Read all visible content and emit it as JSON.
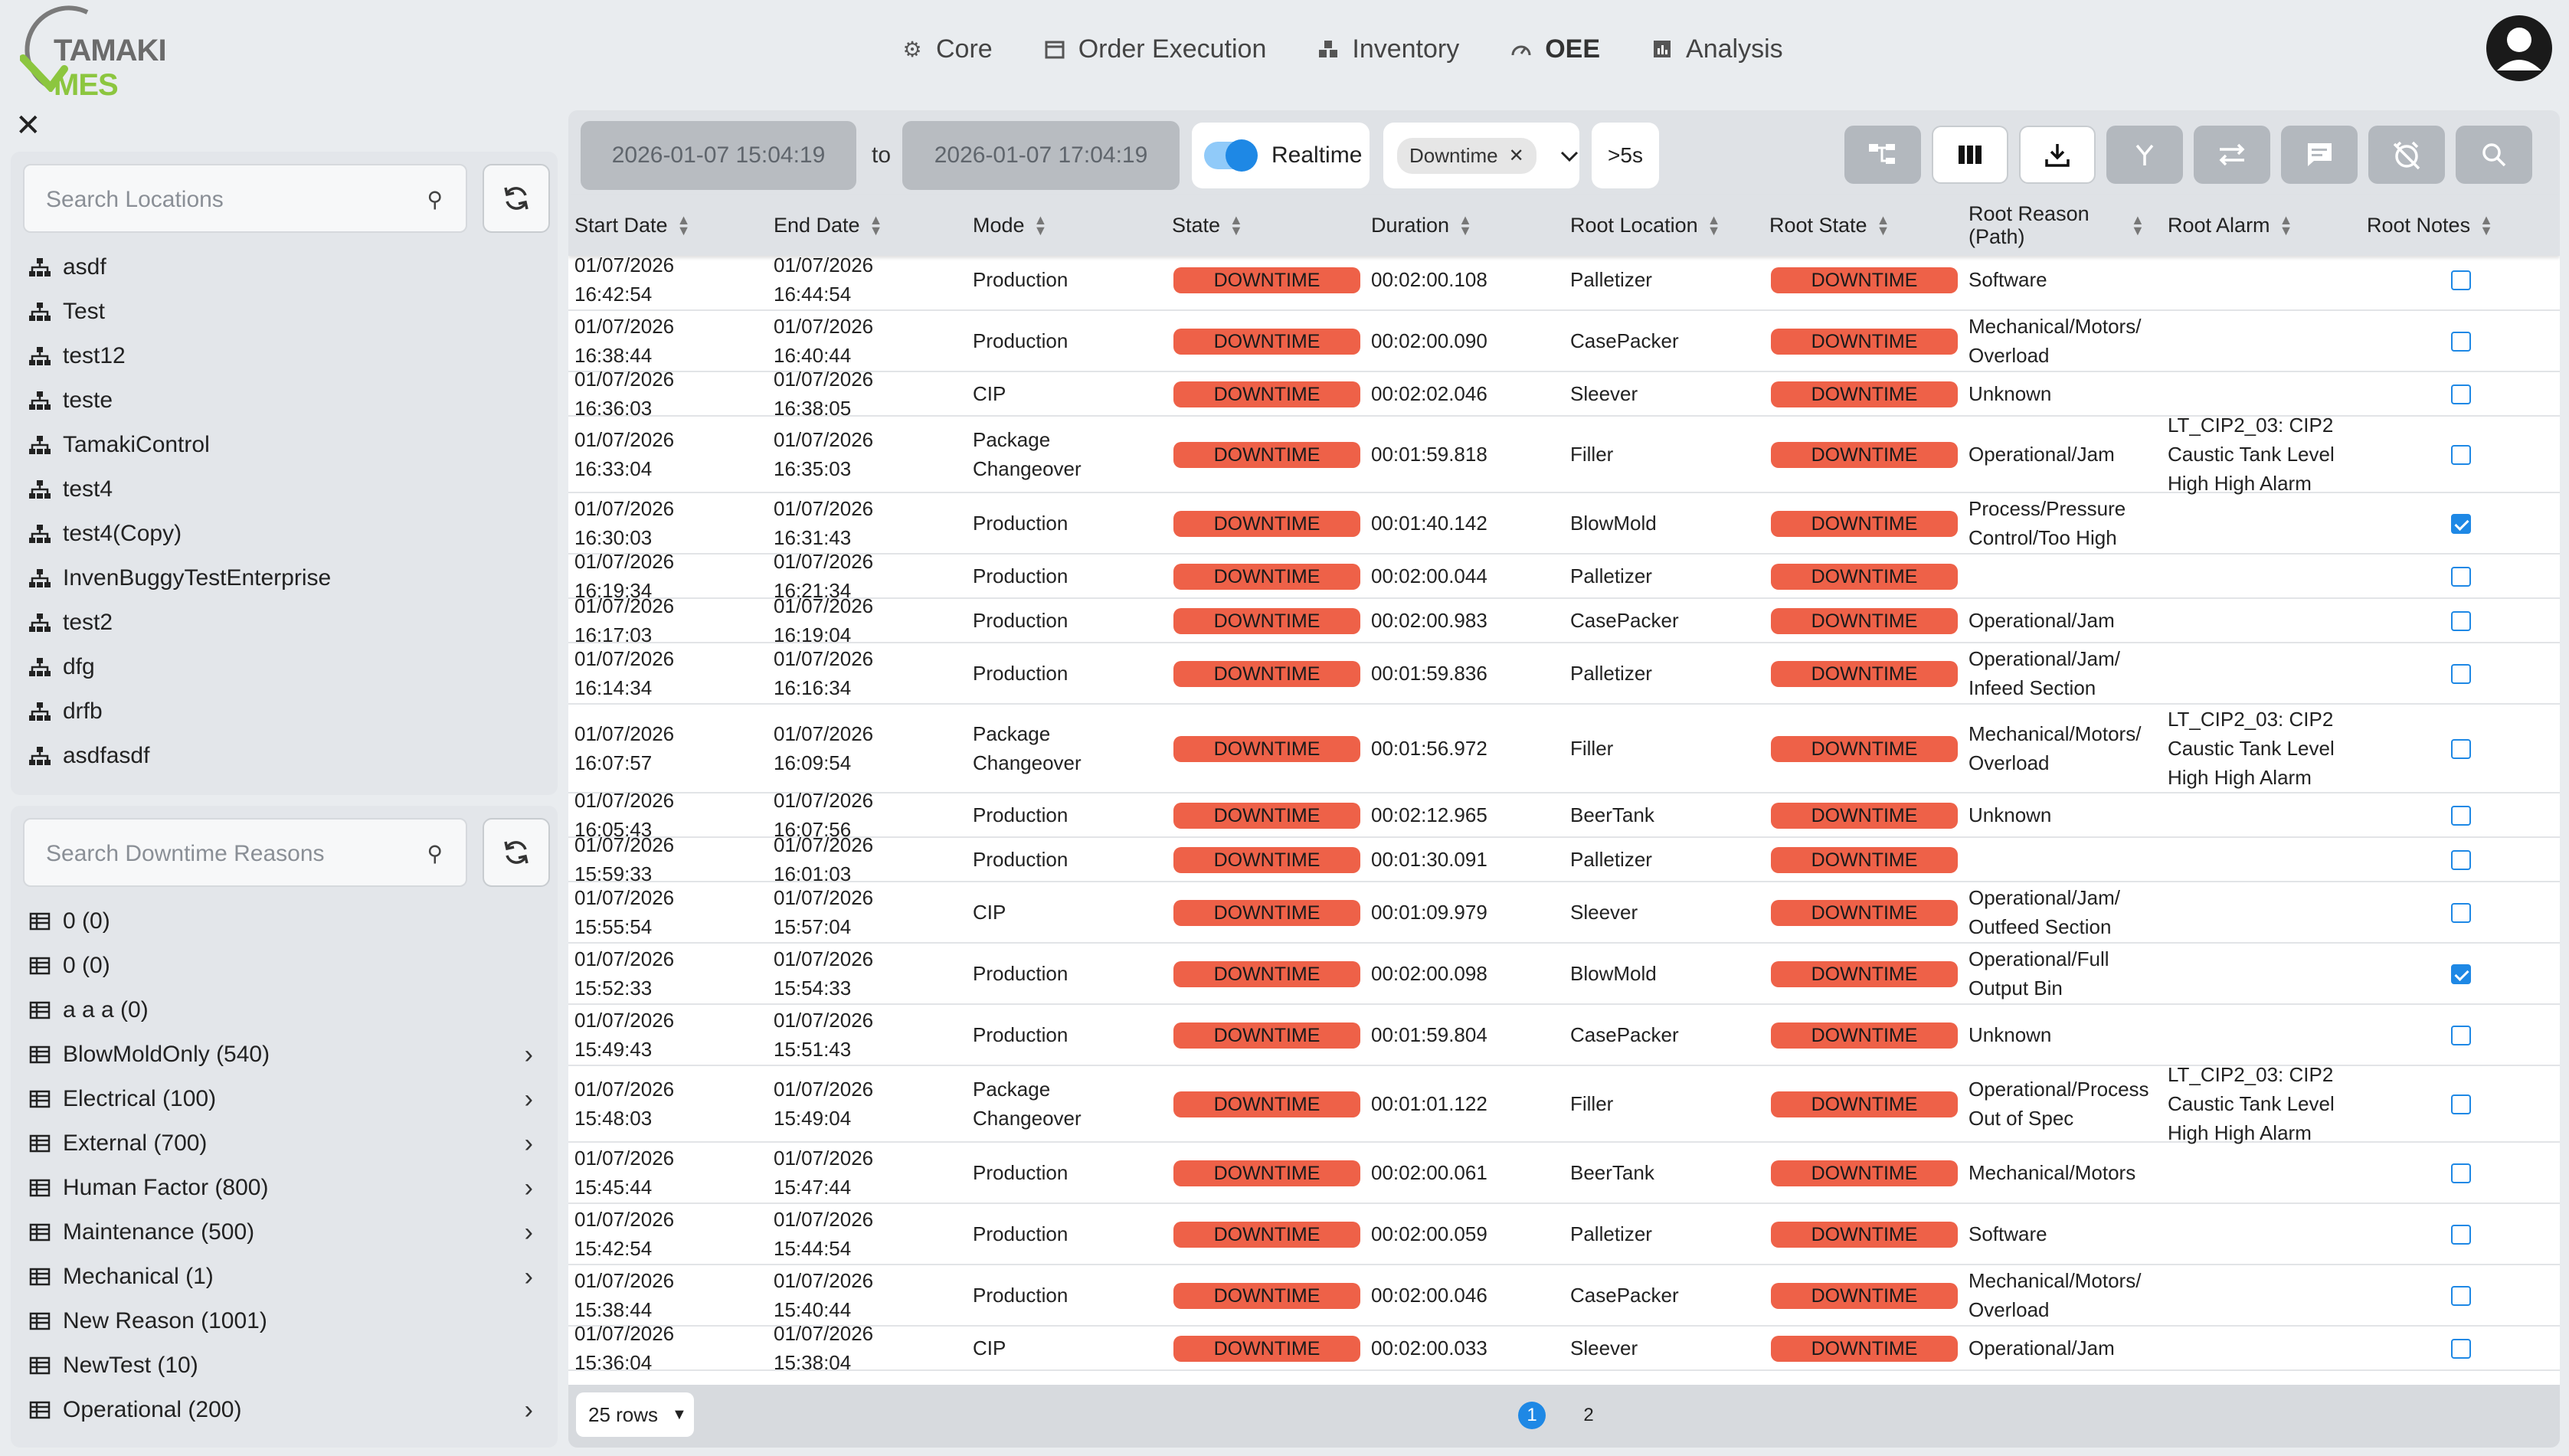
{
  "app": {
    "logo_text_a": "TAMAKI",
    "logo_text_b": "MES"
  },
  "nav": [
    {
      "label": "Core",
      "icon": "gear-icon"
    },
    {
      "label": "Order Execution",
      "icon": "calendar-icon"
    },
    {
      "label": "Inventory",
      "icon": "boxes-icon"
    },
    {
      "label": "OEE",
      "icon": "gauge-icon"
    },
    {
      "label": "Analysis",
      "icon": "chart-icon"
    }
  ],
  "locations": {
    "placeholder": "Search Locations",
    "items": [
      "asdf",
      "Test",
      "test12",
      "teste",
      "TamakiControl",
      "test4",
      "test4(Copy)",
      "InvenBuggyTestEnterprise",
      "test2",
      "dfg",
      "drfb",
      "asdfasdf"
    ]
  },
  "reasons": {
    "placeholder": "Search Downtime Reasons",
    "items": [
      {
        "label": "0 (0)",
        "expandable": false
      },
      {
        "label": "0 (0)",
        "expandable": false
      },
      {
        "label": "a a a (0)",
        "expandable": false
      },
      {
        "label": "BlowMoldOnly (540)",
        "expandable": true
      },
      {
        "label": "Electrical (100)",
        "expandable": true
      },
      {
        "label": "External (700)",
        "expandable": true
      },
      {
        "label": "Human Factor (800)",
        "expandable": true
      },
      {
        "label": "Maintenance (500)",
        "expandable": true
      },
      {
        "label": "Mechanical (1)",
        "expandable": true
      },
      {
        "label": "New Reason (1001)",
        "expandable": false
      },
      {
        "label": "NewTest (10)",
        "expandable": false
      },
      {
        "label": "Operational (200)",
        "expandable": true
      }
    ]
  },
  "toolbar": {
    "start": "2026-01-07 15:04:19",
    "to": "to",
    "end": "2026-01-07 17:04:19",
    "realtime": "Realtime",
    "mode_chip": "Downtime",
    "duration": ">5s"
  },
  "columns": [
    "Start Date",
    "End Date",
    "Mode",
    "State",
    "Duration",
    "Root Location",
    "Root State",
    "Root Reason (Path)",
    "Root Alarm",
    "Root Notes"
  ],
  "colors": {
    "badge": "#ee6148",
    "accent": "#1e88e5"
  },
  "rows": [
    {
      "start": "01/07/2026 16:42:54",
      "end": "01/07/2026 16:44:54",
      "mode": "Production",
      "state": "DOWNTIME",
      "dur": "00:02:00.108",
      "loc": "Palletizer",
      "rstate": "DOWNTIME",
      "reason": "Software",
      "alarm": "",
      "notes": false
    },
    {
      "start": "01/07/2026 16:38:44",
      "end": "01/07/2026 16:40:44",
      "mode": "Production",
      "state": "DOWNTIME",
      "dur": "00:02:00.090",
      "loc": "CasePacker",
      "rstate": "DOWNTIME",
      "reason": "Mechanical/Motors/ Overload",
      "alarm": "",
      "notes": false
    },
    {
      "start": "01/07/2026 16:36:03",
      "end": "01/07/2026 16:38:05",
      "mode": "CIP",
      "state": "DOWNTIME",
      "dur": "00:02:02.046",
      "loc": "Sleever",
      "rstate": "DOWNTIME",
      "reason": "Unknown",
      "alarm": "",
      "notes": false
    },
    {
      "start": "01/07/2026 16:33:04",
      "end": "01/07/2026 16:35:03",
      "mode": "Package Changeover",
      "state": "DOWNTIME",
      "dur": "00:01:59.818",
      "loc": "Filler",
      "rstate": "DOWNTIME",
      "reason": "Operational/Jam",
      "alarm": "LT_CIP2_03: CIP2 Caustic Tank Level High High Alarm",
      "notes": false
    },
    {
      "start": "01/07/2026 16:30:03",
      "end": "01/07/2026 16:31:43",
      "mode": "Production",
      "state": "DOWNTIME",
      "dur": "00:01:40.142",
      "loc": "BlowMold",
      "rstate": "DOWNTIME",
      "reason": "Process/Pressure Control/Too High",
      "alarm": "",
      "notes": true
    },
    {
      "start": "01/07/2026 16:19:34",
      "end": "01/07/2026 16:21:34",
      "mode": "Production",
      "state": "DOWNTIME",
      "dur": "00:02:00.044",
      "loc": "Palletizer",
      "rstate": "DOWNTIME",
      "reason": "",
      "alarm": "",
      "notes": false
    },
    {
      "start": "01/07/2026 16:17:03",
      "end": "01/07/2026 16:19:04",
      "mode": "Production",
      "state": "DOWNTIME",
      "dur": "00:02:00.983",
      "loc": "CasePacker",
      "rstate": "DOWNTIME",
      "reason": "Operational/Jam",
      "alarm": "",
      "notes": false
    },
    {
      "start": "01/07/2026 16:14:34",
      "end": "01/07/2026 16:16:34",
      "mode": "Production",
      "state": "DOWNTIME",
      "dur": "00:01:59.836",
      "loc": "Palletizer",
      "rstate": "DOWNTIME",
      "reason": "Operational/Jam/ Infeed Section",
      "alarm": "",
      "notes": false
    },
    {
      "start": "01/07/2026 16:07:57",
      "end": "01/07/2026 16:09:54",
      "mode": "Package Changeover",
      "state": "DOWNTIME",
      "dur": "00:01:56.972",
      "loc": "Filler",
      "rstate": "DOWNTIME",
      "reason": "Mechanical/Motors/ Overload",
      "alarm": "LT_CIP2_03: CIP2 Caustic Tank Level High High Alarm",
      "notes": false
    },
    {
      "start": "01/07/2026 16:05:43",
      "end": "01/07/2026 16:07:56",
      "mode": "Production",
      "state": "DOWNTIME",
      "dur": "00:02:12.965",
      "loc": "BeerTank",
      "rstate": "DOWNTIME",
      "reason": "Unknown",
      "alarm": "",
      "notes": false
    },
    {
      "start": "01/07/2026 15:59:33",
      "end": "01/07/2026 16:01:03",
      "mode": "Production",
      "state": "DOWNTIME",
      "dur": "00:01:30.091",
      "loc": "Palletizer",
      "rstate": "DOWNTIME",
      "reason": "",
      "alarm": "",
      "notes": false
    },
    {
      "start": "01/07/2026 15:55:54",
      "end": "01/07/2026 15:57:04",
      "mode": "CIP",
      "state": "DOWNTIME",
      "dur": "00:01:09.979",
      "loc": "Sleever",
      "rstate": "DOWNTIME",
      "reason": "Operational/Jam/ Outfeed Section",
      "alarm": "",
      "notes": false
    },
    {
      "start": "01/07/2026 15:52:33",
      "end": "01/07/2026 15:54:33",
      "mode": "Production",
      "state": "DOWNTIME",
      "dur": "00:02:00.098",
      "loc": "BlowMold",
      "rstate": "DOWNTIME",
      "reason": "Operational/Full Output Bin",
      "alarm": "",
      "notes": true
    },
    {
      "start": "01/07/2026 15:49:43",
      "end": "01/07/2026 15:51:43",
      "mode": "Production",
      "state": "DOWNTIME",
      "dur": "00:01:59.804",
      "loc": "CasePacker",
      "rstate": "DOWNTIME",
      "reason": "Unknown",
      "alarm": "",
      "notes": false
    },
    {
      "start": "01/07/2026 15:48:03",
      "end": "01/07/2026 15:49:04",
      "mode": "Package Changeover",
      "state": "DOWNTIME",
      "dur": "00:01:01.122",
      "loc": "Filler",
      "rstate": "DOWNTIME",
      "reason": "Operational/Process Out of Spec",
      "alarm": "LT_CIP2_03: CIP2 Caustic Tank Level High High Alarm",
      "notes": false
    },
    {
      "start": "01/07/2026 15:45:44",
      "end": "01/07/2026 15:47:44",
      "mode": "Production",
      "state": "DOWNTIME",
      "dur": "00:02:00.061",
      "loc": "BeerTank",
      "rstate": "DOWNTIME",
      "reason": "Mechanical/Motors",
      "alarm": "",
      "notes": false
    },
    {
      "start": "01/07/2026 15:42:54",
      "end": "01/07/2026 15:44:54",
      "mode": "Production",
      "state": "DOWNTIME",
      "dur": "00:02:00.059",
      "loc": "Palletizer",
      "rstate": "DOWNTIME",
      "reason": "Software",
      "alarm": "",
      "notes": false
    },
    {
      "start": "01/07/2026 15:38:44",
      "end": "01/07/2026 15:40:44",
      "mode": "Production",
      "state": "DOWNTIME",
      "dur": "00:02:00.046",
      "loc": "CasePacker",
      "rstate": "DOWNTIME",
      "reason": "Mechanical/Motors/ Overload",
      "alarm": "",
      "notes": false
    },
    {
      "start": "01/07/2026 15:36:04",
      "end": "01/07/2026 15:38:04",
      "mode": "CIP",
      "state": "DOWNTIME",
      "dur": "00:02:00.033",
      "loc": "Sleever",
      "rstate": "DOWNTIME",
      "reason": "Operational/Jam",
      "alarm": "",
      "notes": false
    }
  ],
  "footer": {
    "rows_label": "25 rows",
    "pages": [
      "1",
      "2"
    ],
    "current_page": "1"
  }
}
